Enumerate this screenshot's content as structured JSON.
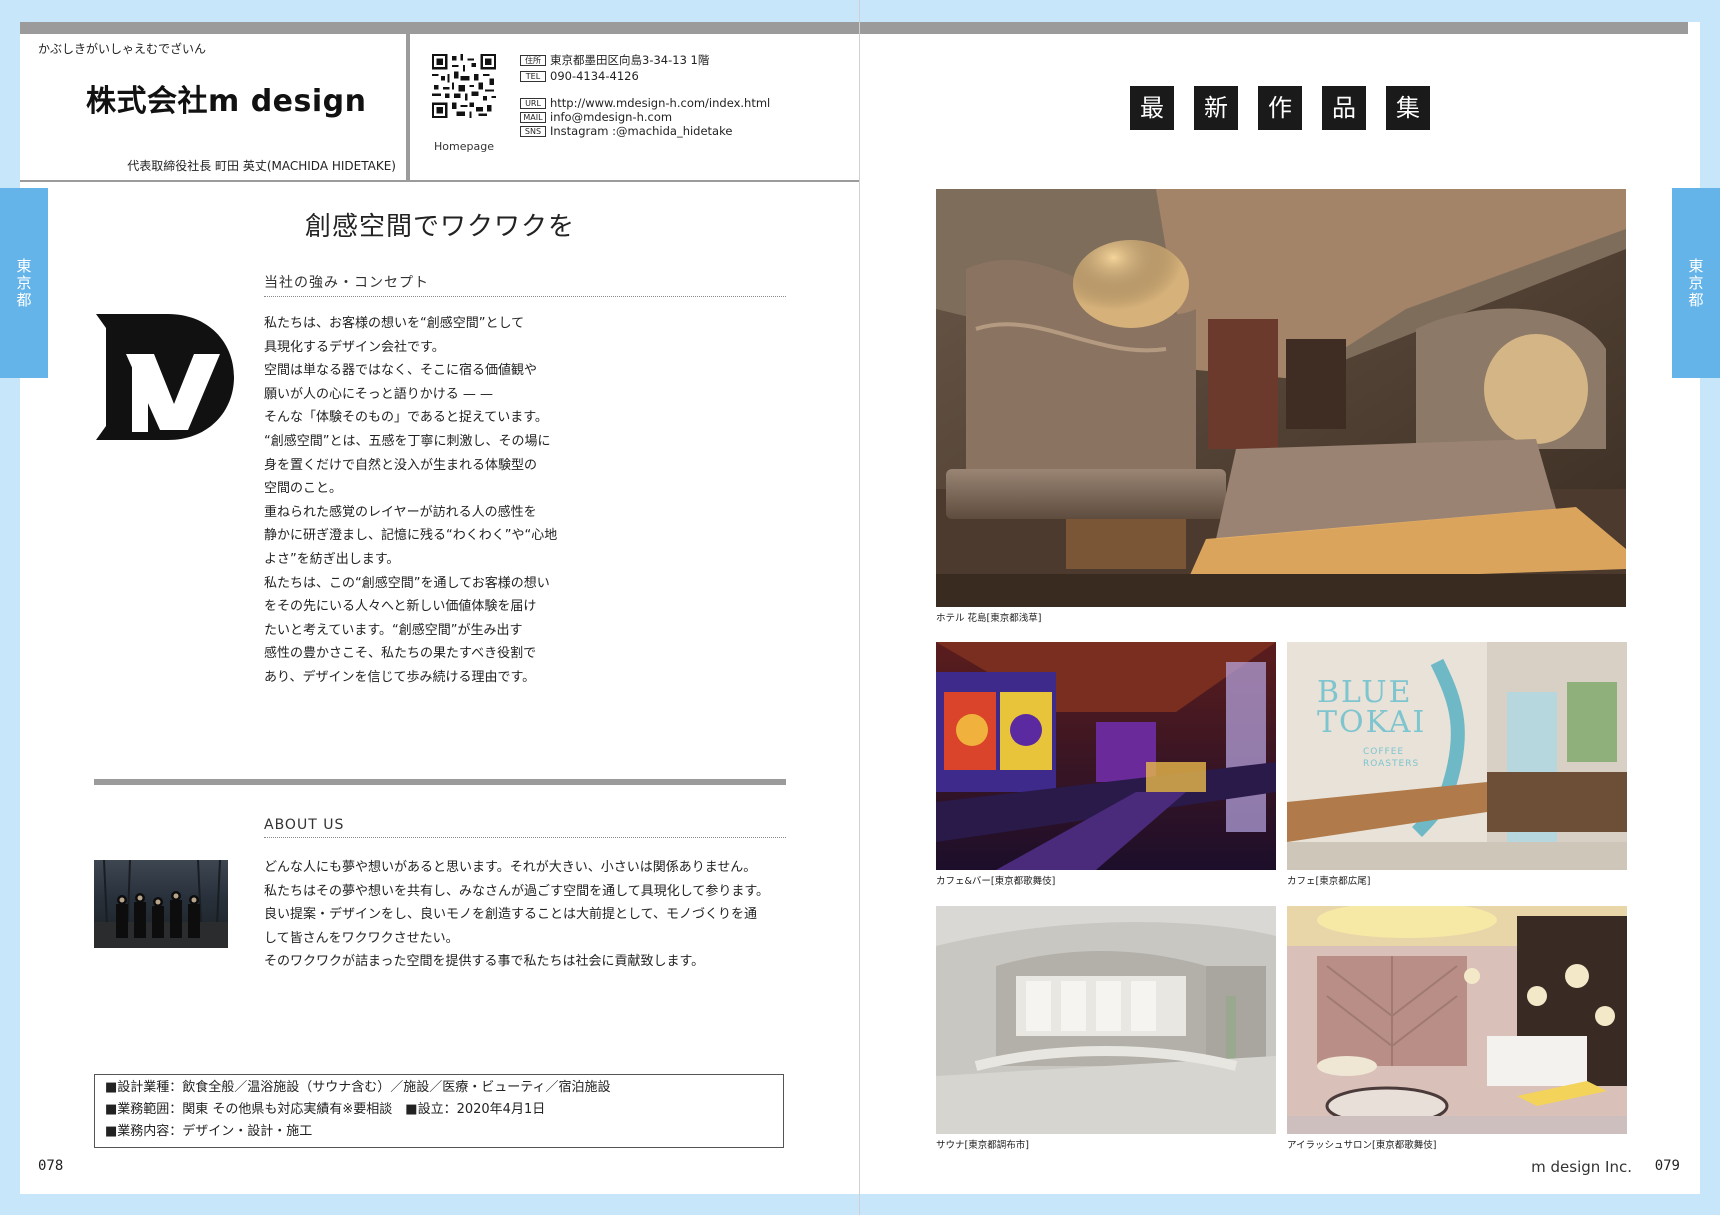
{
  "header": {
    "kana": "かぶしきがいしゃえむでざいん",
    "company_name": "株式会社m design",
    "representative": "代表取締役社長 町田 英丈(MACHIDA HIDETAKE)",
    "qr_label": "Homepage",
    "info": [
      {
        "tag": "住所",
        "value": "東京都墨田区向島3-34-13 1階"
      },
      {
        "tag": "TEL",
        "value": "090-4134-4126"
      },
      {
        "tag": "URL",
        "value": "http://www.mdesign-h.com/index.html"
      },
      {
        "tag": "MAIL",
        "value": "info@mdesign-h.com"
      },
      {
        "tag": "SNS",
        "value": "Instagram :@machida_hidetake"
      }
    ]
  },
  "side_tab": "東京都",
  "left": {
    "headline": "創感空間でワクワクを",
    "concept_title": "当社の強み・コンセプト",
    "concept_text": "私たちは、お客様の想いを“創感空間”として\n具現化するデザイン会社です。\n空間は単なる器ではなく、そこに宿る価値観や\n願いが人の心にそっと語りかける — —\nそんな「体験そのもの」であると捉えています。\n“創感空間”とは、五感を丁寧に刺激し、その場に\n身を置くだけで自然と没入が生まれる体験型の\n空間のこと。\n重ねられた感覚のレイヤーが訪れる人の感性を\n静かに研ぎ澄まし、記憶に残る“わくわく”や“心地\nよさ”を紡ぎ出します。\n私たちは、この“創感空間”を通してお客様の想い\nをその先にいる人々へと新しい価値体験を届け\nたいと考えています。“創感空間”が生み出す\n感性の豊かさこそ、私たちの果たすべき役割で\nあり、デザインを信じて歩み続ける理由です。",
    "about_title": "ABOUT US",
    "about_text": "どんな人にも夢や想いがあると思います。それが大きい、小さいは関係ありません。\n私たちはその夢や想いを共有し、みなさんが過ごす空間を通して具現化して参ります。\n良い提案・デザインをし、良いモノを創造することは大前提として、モノづくりを通\nして皆さんをワクワクさせたい。\nそのワクワクが詰まった空間を提供する事で私たちは社会に貢献致します。",
    "specs": [
      "■設計業種：飲食全般／温浴施設（サウナ含む）／施設／医療・ビューティ／宿泊施設",
      "■業務範囲：関東 その他県も対応実績有※要相談　■設立：2020年4月1日",
      "■業務内容：デザイン・設計・施工"
    ],
    "page_number": "078"
  },
  "right": {
    "kanji": [
      "最",
      "新",
      "作",
      "品",
      "集"
    ],
    "captions": [
      "ホテル 花島[東京都浅草]",
      "カフェ&バー[東京都歌舞伎]",
      "カフェ[東京都広尾]",
      "サウナ[東京都調布市]",
      "アイラッシュサロン[東京都歌舞伎]"
    ],
    "cafe_sign": [
      "BLUE",
      "TOKAI",
      "COFFEE",
      "ROASTERS"
    ],
    "footer_name": "m design Inc.",
    "page_number": "079"
  }
}
